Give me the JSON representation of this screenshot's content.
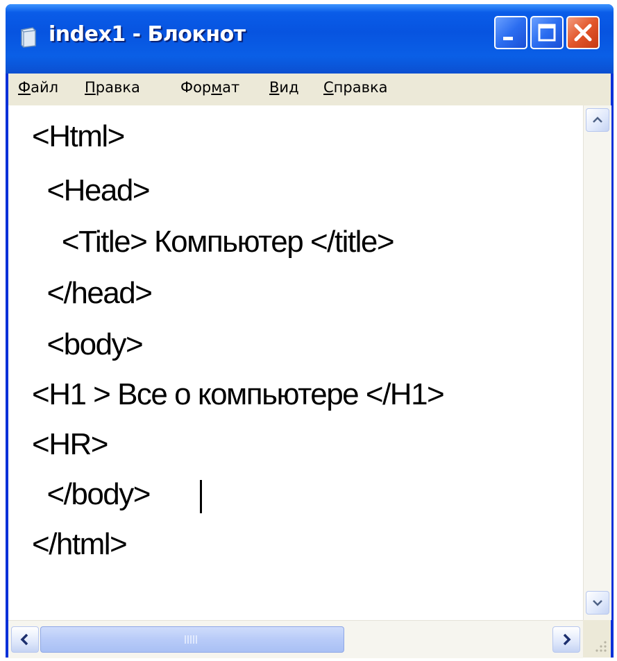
{
  "window": {
    "title": "index1 - Блокнот",
    "icon": "notepad-icon",
    "controls": [
      "minimize-icon",
      "maximize-icon",
      "close-icon"
    ]
  },
  "menu": [
    {
      "label": "Файл",
      "access_key": "Ф",
      "rest": "айл"
    },
    {
      "label": "Правка",
      "access_key": "П",
      "rest": "равка"
    },
    {
      "label": "Формат",
      "pre": "Фор",
      "access_key": "м",
      "rest": "ат"
    },
    {
      "label": "Вид",
      "access_key": "В",
      "rest": "ид"
    },
    {
      "label": "Справка",
      "access_key": "С",
      "rest": "правка"
    }
  ],
  "document": {
    "lines": [
      "<Html>",
      "  <Head>",
      "    <Title> Компьютер </title>",
      "  </head>",
      "  <body>",
      "<H1 > Все о компьютере </H1>",
      "<HR>",
      "  </body>",
      "</html>"
    ],
    "caret_line": 7
  },
  "colors": {
    "titlebar": "#0754e0",
    "close_button": "#e2562a",
    "menubar": "#ece9d8",
    "editor_bg": "#ffffff"
  }
}
